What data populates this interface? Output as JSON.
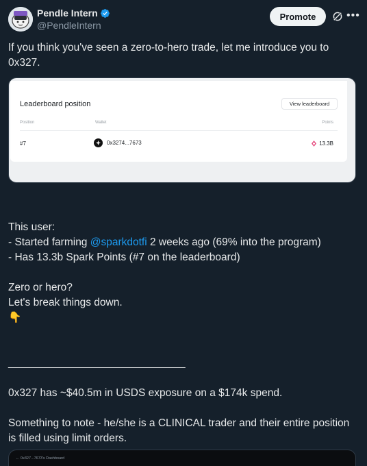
{
  "author": {
    "display_name": "Pendle Intern",
    "handle": "@PendleIntern",
    "verified": true
  },
  "actions": {
    "promote_label": "Promote",
    "grok_icon": "grok-icon",
    "more_icon": "more-icon"
  },
  "tweet": {
    "intro": "If you think you've seen a zero-to-hero trade, let me introduce you to 0x327.",
    "body": {
      "line1": "This user:",
      "line2_prefix": "- Started farming ",
      "mention": "@sparkdotfi",
      "line2_suffix": " 2 weeks ago (69% into the program)",
      "line3": "- Has 13.3b Spark Points (#7 on the leaderboard)",
      "line4": "Zero or hero?",
      "line5": "Let's break things down.",
      "emoji": "👇",
      "divider": "______________________________",
      "line6": "0x327 has ~$40.5m in USDS exposure on a $174k spend.",
      "line7": "Something to note - he/she is a CLINICAL trader and their entire position is filled using limit orders."
    }
  },
  "leaderboard_card": {
    "title": "Leaderboard position",
    "button_label": "View leaderboard",
    "columns": [
      "Position",
      "Wallet",
      "Points"
    ],
    "row": {
      "position": "#7",
      "wallet": "0x3274...7673",
      "points": "13.3B"
    },
    "accent_color": "#e6487d"
  },
  "second_card": {
    "label": "← 0x327...7673's Dashboard"
  }
}
